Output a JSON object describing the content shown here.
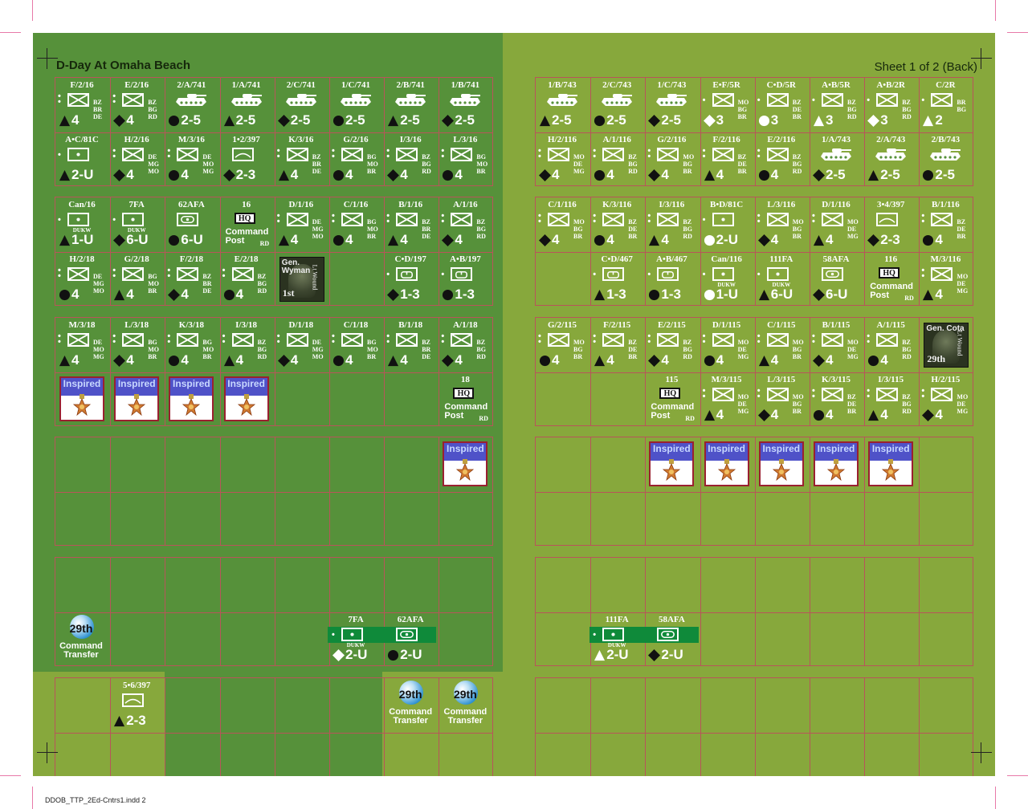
{
  "title": "D-Day At Omaha Beach",
  "sheet_label": "Sheet 1 of 2 (Back)",
  "footer": "DDOB_TTP_2Ed-Cntrs1.indd   2",
  "icon_legend": [
    "infantry-icon",
    "tank-icon",
    "recon-icon",
    "artillery-icon",
    "weapons-icon",
    "engineer-icon",
    "hq-icon",
    "medal-icon",
    "general-portrait-icon",
    "division-disc-icon"
  ],
  "colors": {
    "sheet_light": "#87a83c",
    "sheet_dark": "#56913a",
    "grid_line": "#b8555a",
    "bar_green": "#0f8a3a"
  },
  "counters": [
    {
      "label": "F/2/16",
      "type": "inf",
      "dots": 2,
      "caps": [
        "BZ",
        "BR",
        "DE"
      ],
      "shape": "tri",
      "value": "4"
    },
    {
      "label": "E/2/16",
      "type": "inf",
      "dots": 2,
      "caps": [
        "BZ",
        "BG",
        "RD"
      ],
      "shape": "dia",
      "value": "4"
    },
    {
      "label": "2/A/741",
      "type": "tank",
      "dots": 0,
      "caps": [],
      "shape": "cir",
      "value": "2-5"
    },
    {
      "label": "1/A/741",
      "type": "tank",
      "dots": 0,
      "caps": [],
      "shape": "tri",
      "value": "2-5"
    },
    {
      "label": "2/C/741",
      "type": "tank",
      "dots": 0,
      "caps": [],
      "shape": "dia",
      "value": "2-5"
    },
    {
      "label": "1/C/741",
      "type": "tank",
      "dots": 0,
      "caps": [],
      "shape": "cir",
      "value": "2-5"
    },
    {
      "label": "2/B/741",
      "type": "tank",
      "dots": 0,
      "caps": [],
      "shape": "tri",
      "value": "2-5"
    },
    {
      "label": "1/B/741",
      "type": "tank",
      "dots": 0,
      "caps": [],
      "shape": "dia",
      "value": "2-5"
    },
    {
      "label": "A•C/81C",
      "type": "recon",
      "dots": 1,
      "caps": [],
      "shape": "tri",
      "value": "2-U"
    },
    {
      "label": "H/2/16",
      "type": "inf",
      "dots": 2,
      "caps": [
        "DE",
        "MG",
        "MO"
      ],
      "shape": "dia",
      "value": "4"
    },
    {
      "label": "M/3/16",
      "type": "inf",
      "dots": 2,
      "caps": [
        "DE",
        "MO",
        "MG"
      ],
      "shape": "cir",
      "value": "4"
    },
    {
      "label": "1•2/397",
      "type": "weap",
      "dots": 0,
      "caps": [],
      "shape": "dia",
      "value": "2-3"
    },
    {
      "label": "K/3/16",
      "type": "inf",
      "dots": 2,
      "caps": [
        "BZ",
        "BR",
        "DE"
      ],
      "shape": "tri",
      "value": "4"
    },
    {
      "label": "G/2/16",
      "type": "inf",
      "dots": 2,
      "caps": [
        "BG",
        "MO",
        "BR"
      ],
      "shape": "cir",
      "value": "4"
    },
    {
      "label": "I/3/16",
      "type": "inf",
      "dots": 2,
      "caps": [
        "BZ",
        "BG",
        "RD"
      ],
      "shape": "dia",
      "value": "4"
    },
    {
      "label": "L/3/16",
      "type": "inf",
      "dots": 2,
      "caps": [
        "BG",
        "MO",
        "BR"
      ],
      "shape": "cir",
      "value": "4"
    },
    {
      "label": "Can/16",
      "type": "recon",
      "dots": 1,
      "sub": "DUKW",
      "caps": [],
      "shape": "tri",
      "value": "1-U"
    },
    {
      "label": "7FA",
      "type": "recon",
      "dots": 1,
      "sub": "DUKW",
      "caps": [],
      "shape": "dia",
      "value": "6-U"
    },
    {
      "label": "62AFA",
      "type": "art",
      "dots": 0,
      "caps": [],
      "shape": "cir",
      "value": "6-U"
    },
    {
      "label": "16",
      "type": "hq",
      "hq": "HQ",
      "cp": [
        "Command",
        "Post"
      ],
      "rd": "RD"
    },
    {
      "label": "D/1/16",
      "type": "inf",
      "dots": 2,
      "caps": [
        "DE",
        "MG",
        "MO"
      ],
      "shape": "tri",
      "value": "4"
    },
    {
      "label": "C/1/16",
      "type": "inf",
      "dots": 2,
      "caps": [
        "BG",
        "MO",
        "BR"
      ],
      "shape": "cir",
      "value": "4"
    },
    {
      "label": "B/1/16",
      "type": "inf",
      "dots": 2,
      "caps": [
        "BZ",
        "BR",
        "DE"
      ],
      "shape": "tri",
      "value": "4"
    },
    {
      "label": "A/1/16",
      "type": "inf",
      "dots": 2,
      "caps": [
        "BZ",
        "BG",
        "RD"
      ],
      "shape": "dia",
      "value": "4"
    },
    {
      "label": "H/2/18",
      "type": "inf",
      "dots": 2,
      "caps": [
        "DE",
        "MG",
        "MO"
      ],
      "shape": "cir",
      "value": "4"
    },
    {
      "label": "G/2/18",
      "type": "inf",
      "dots": 2,
      "caps": [
        "BG",
        "MO",
        "BR"
      ],
      "shape": "tri",
      "value": "4"
    },
    {
      "label": "F/2/18",
      "type": "inf",
      "dots": 2,
      "caps": [
        "BZ",
        "BR",
        "DE"
      ],
      "shape": "dia",
      "value": "4"
    },
    {
      "label": "E/2/18",
      "type": "inf",
      "dots": 2,
      "caps": [
        "BZ",
        "BG",
        "RD"
      ],
      "shape": "cir",
      "value": "4"
    },
    {
      "label": "C•D/197",
      "type": "eng",
      "dots": 1,
      "caps": [],
      "shape": "dia",
      "value": "1-3"
    },
    {
      "label": "A•B/197",
      "type": "eng",
      "dots": 1,
      "caps": [],
      "shape": "cir",
      "value": "1-3"
    },
    {
      "label": "M/3/18",
      "type": "inf",
      "dots": 2,
      "caps": [
        "DE",
        "MO",
        "MG"
      ],
      "shape": "tri",
      "value": "4"
    },
    {
      "label": "L/3/18",
      "type": "inf",
      "dots": 2,
      "caps": [
        "BG",
        "MO",
        "BR"
      ],
      "shape": "dia",
      "value": "4"
    },
    {
      "label": "K/3/18",
      "type": "inf",
      "dots": 2,
      "caps": [
        "BG",
        "MO",
        "BR"
      ],
      "shape": "cir",
      "value": "4"
    },
    {
      "label": "I/3/18",
      "type": "inf",
      "dots": 2,
      "caps": [
        "BZ",
        "BG",
        "RD"
      ],
      "shape": "tri",
      "value": "4"
    },
    {
      "label": "D/1/18",
      "type": "inf",
      "dots": 2,
      "caps": [
        "DE",
        "MG",
        "MO"
      ],
      "shape": "dia",
      "value": "4"
    },
    {
      "label": "C/1/18",
      "type": "inf",
      "dots": 2,
      "caps": [
        "BG",
        "MO",
        "BR"
      ],
      "shape": "cir",
      "value": "4"
    },
    {
      "label": "B/1/18",
      "type": "inf",
      "dots": 2,
      "caps": [
        "BZ",
        "BR",
        "DE"
      ],
      "shape": "tri",
      "value": "4"
    },
    {
      "label": "A/1/18",
      "type": "inf",
      "dots": 2,
      "caps": [
        "BZ",
        "BG",
        "RD"
      ],
      "shape": "dia",
      "value": "4"
    },
    {
      "label": "18",
      "type": "hq",
      "hq": "HQ",
      "cp": [
        "Command",
        "Post"
      ],
      "rd": "RD"
    },
    {
      "label": "5•6/397",
      "type": "weap",
      "dots": 0,
      "caps": [],
      "shape": "tri",
      "value": "2-3"
    },
    {
      "label": "1/B/743",
      "type": "tank",
      "dots": 0,
      "caps": [],
      "shape": "tri",
      "value": "2-5"
    },
    {
      "label": "2/C/743",
      "type": "tank",
      "dots": 0,
      "caps": [],
      "shape": "cir",
      "value": "2-5"
    },
    {
      "label": "1/C/743",
      "type": "tank",
      "dots": 0,
      "caps": [],
      "shape": "dia",
      "value": "2-5"
    },
    {
      "label": "E•F/5R",
      "type": "inf",
      "dots": 1,
      "caps": [
        "MO",
        "BG",
        "BR"
      ],
      "shape": "odia",
      "value": "3"
    },
    {
      "label": "C•D/5R",
      "type": "inf",
      "dots": 1,
      "caps": [
        "BZ",
        "DE",
        "BR"
      ],
      "shape": "ocir",
      "value": "3"
    },
    {
      "label": "A•B/5R",
      "type": "inf",
      "dots": 1,
      "caps": [
        "BZ",
        "BG",
        "RD"
      ],
      "shape": "otri",
      "value": "3"
    },
    {
      "label": "A•B/2R",
      "type": "inf",
      "dots": 1,
      "caps": [
        "BZ",
        "BG",
        "RD"
      ],
      "shape": "odia",
      "value": "3"
    },
    {
      "label": "C/2R",
      "type": "inf",
      "dots": 1,
      "caps": [
        "BR",
        "BG"
      ],
      "shape": "otri",
      "value": "2"
    },
    {
      "label": "H/2/116",
      "type": "inf",
      "dots": 2,
      "caps": [
        "MO",
        "DE",
        "MG"
      ],
      "shape": "dia",
      "value": "4"
    },
    {
      "label": "A/1/116",
      "type": "inf",
      "dots": 2,
      "caps": [
        "BZ",
        "BG",
        "RD"
      ],
      "shape": "cir",
      "value": "4"
    },
    {
      "label": "G/2/116",
      "type": "inf",
      "dots": 2,
      "caps": [
        "MO",
        "BG",
        "BR"
      ],
      "shape": "dia",
      "value": "4"
    },
    {
      "label": "F/2/116",
      "type": "inf",
      "dots": 2,
      "caps": [
        "BZ",
        "DE",
        "BR"
      ],
      "shape": "tri",
      "value": "4"
    },
    {
      "label": "E/2/116",
      "type": "inf",
      "dots": 2,
      "caps": [
        "BZ",
        "BG",
        "RD"
      ],
      "shape": "cir",
      "value": "4"
    },
    {
      "label": "1/A/743",
      "type": "tank",
      "dots": 0,
      "caps": [],
      "shape": "dia",
      "value": "2-5"
    },
    {
      "label": "2/A/743",
      "type": "tank",
      "dots": 0,
      "caps": [],
      "shape": "tri",
      "value": "2-5"
    },
    {
      "label": "2/B/743",
      "type": "tank",
      "dots": 0,
      "caps": [],
      "shape": "cir",
      "value": "2-5"
    },
    {
      "label": "C/1/116",
      "type": "inf",
      "dots": 2,
      "caps": [
        "MO",
        "BG",
        "BR"
      ],
      "shape": "dia",
      "value": "4"
    },
    {
      "label": "K/3/116",
      "type": "inf",
      "dots": 2,
      "caps": [
        "BZ",
        "DE",
        "BR"
      ],
      "shape": "cir",
      "value": "4"
    },
    {
      "label": "I/3/116",
      "type": "inf",
      "dots": 2,
      "caps": [
        "BZ",
        "BG",
        "RD"
      ],
      "shape": "tri",
      "value": "4"
    },
    {
      "label": "B•D/81C",
      "type": "recon",
      "dots": 1,
      "caps": [],
      "shape": "ocir",
      "value": "2-U"
    },
    {
      "label": "L/3/116",
      "type": "inf",
      "dots": 2,
      "caps": [
        "MO",
        "BG",
        "BR"
      ],
      "shape": "dia",
      "value": "4"
    },
    {
      "label": "D/1/116",
      "type": "inf",
      "dots": 2,
      "caps": [
        "MO",
        "DE",
        "MG"
      ],
      "shape": "tri",
      "value": "4"
    },
    {
      "label": "3•4/397",
      "type": "weap",
      "dots": 0,
      "caps": [],
      "shape": "dia",
      "value": "2-3"
    },
    {
      "label": "B/1/116",
      "type": "inf",
      "dots": 2,
      "caps": [
        "BZ",
        "DE",
        "BR"
      ],
      "shape": "cir",
      "value": "4"
    },
    {
      "label": "C•D/467",
      "type": "eng",
      "dots": 1,
      "caps": [],
      "shape": "tri",
      "value": "1-3"
    },
    {
      "label": "A•B/467",
      "type": "eng",
      "dots": 1,
      "caps": [],
      "shape": "cir",
      "value": "1-3"
    },
    {
      "label": "Can/116",
      "type": "recon",
      "dots": 1,
      "sub": "DUKW",
      "caps": [],
      "shape": "ocir",
      "value": "1-U"
    },
    {
      "label": "111FA",
      "type": "recon",
      "dots": 1,
      "sub": "DUKW",
      "caps": [],
      "shape": "tri",
      "value": "6-U"
    },
    {
      "label": "58AFA",
      "type": "art",
      "dots": 0,
      "caps": [],
      "shape": "dia",
      "value": "6-U"
    },
    {
      "label": "116",
      "type": "hq",
      "hq": "HQ",
      "cp": [
        "Command",
        "Post"
      ],
      "rd": "RD"
    },
    {
      "label": "M/3/116",
      "type": "inf",
      "dots": 2,
      "caps": [
        "MO",
        "DE",
        "MG"
      ],
      "shape": "tri",
      "value": "4"
    },
    {
      "label": "G/2/115",
      "type": "inf",
      "dots": 2,
      "caps": [
        "MO",
        "BG",
        "BR"
      ],
      "shape": "cir",
      "value": "4"
    },
    {
      "label": "F/2/115",
      "type": "inf",
      "dots": 2,
      "caps": [
        "BZ",
        "DE",
        "BR"
      ],
      "shape": "tri",
      "value": "4"
    },
    {
      "label": "E/2/115",
      "type": "inf",
      "dots": 2,
      "caps": [
        "BZ",
        "BG",
        "RD"
      ],
      "shape": "dia",
      "value": "4"
    },
    {
      "label": "D/1/115",
      "type": "inf",
      "dots": 2,
      "caps": [
        "MO",
        "DE",
        "MG"
      ],
      "shape": "cir",
      "value": "4"
    },
    {
      "label": "C/1/115",
      "type": "inf",
      "dots": 2,
      "caps": [
        "MO",
        "BG",
        "BR"
      ],
      "shape": "tri",
      "value": "4"
    },
    {
      "label": "B/1/115",
      "type": "inf",
      "dots": 2,
      "caps": [
        "MO",
        "DE",
        "MG"
      ],
      "shape": "dia",
      "value": "4"
    },
    {
      "label": "A/1/115",
      "type": "inf",
      "dots": 2,
      "caps": [
        "BZ",
        "BG",
        "RD"
      ],
      "shape": "cir",
      "value": "4"
    },
    {
      "label": "115",
      "type": "hq",
      "hq": "HQ",
      "cp": [
        "Command",
        "Post"
      ],
      "rd": "RD"
    },
    {
      "label": "M/3/115",
      "type": "inf",
      "dots": 2,
      "caps": [
        "MO",
        "DE",
        "MG"
      ],
      "shape": "tri",
      "value": "4"
    },
    {
      "label": "L/3/115",
      "type": "inf",
      "dots": 2,
      "caps": [
        "MO",
        "BG",
        "BR"
      ],
      "shape": "dia",
      "value": "4"
    },
    {
      "label": "K/3/115",
      "type": "inf",
      "dots": 2,
      "caps": [
        "BZ",
        "DE",
        "BR"
      ],
      "shape": "cir",
      "value": "4"
    },
    {
      "label": "I/3/115",
      "type": "inf",
      "dots": 2,
      "caps": [
        "BZ",
        "BG",
        "RD"
      ],
      "shape": "tri",
      "value": "4"
    },
    {
      "label": "H/2/115",
      "type": "inf",
      "dots": 2,
      "caps": [
        "MO",
        "DE",
        "MG"
      ],
      "shape": "dia",
      "value": "4"
    }
  ],
  "inspired": {
    "text": "Inspired"
  },
  "generals": [
    {
      "name": [
        "Gen.",
        "Wyman"
      ],
      "wound": "Lt Wound",
      "division": "1st"
    },
    {
      "name": [
        "Gen. Cota"
      ],
      "wound": "Lt Wound",
      "division": "29th"
    }
  ],
  "command_transfer": {
    "division": "29th",
    "lines": [
      "Command",
      "Transfer"
    ]
  },
  "bar_counters": [
    {
      "label": "7FA",
      "type": "recon",
      "sub": "DUKW",
      "shape": "odia",
      "value": "2-U"
    },
    {
      "label": "62AFA",
      "type": "art",
      "shape": "cir",
      "value": "2-U"
    },
    {
      "label": "111FA",
      "type": "recon",
      "sub": "DUKW",
      "shape": "otri",
      "value": "2-U"
    },
    {
      "label": "58AFA",
      "type": "art",
      "shape": "dia",
      "value": "2-U"
    }
  ]
}
